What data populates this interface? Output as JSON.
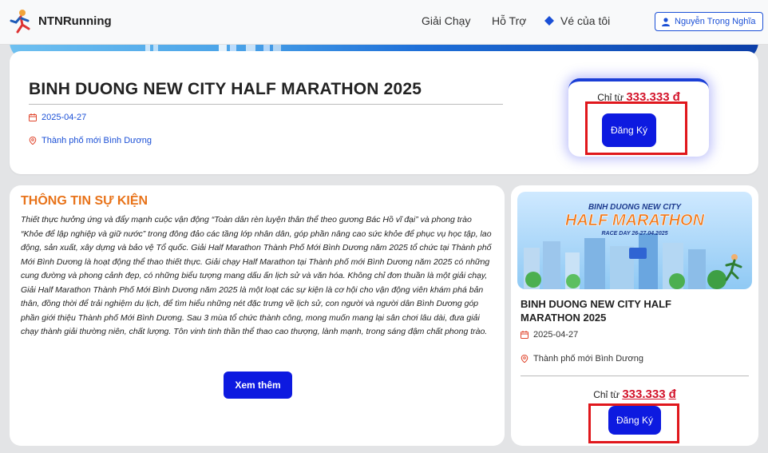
{
  "navbar": {
    "brand": "NTNRunning",
    "links": {
      "races": "Giải Chạy",
      "support": "Hỗ Trợ",
      "tickets": "Vé của tôi"
    },
    "user_name": "Nguyễn Trọng Nghĩa"
  },
  "event": {
    "title": "BINH DUONG NEW CITY HALF MARATHON 2025",
    "date": "2025-04-27",
    "location": "Thành phố mới Bình Dương",
    "price_prefix": "Chỉ từ",
    "price_value": "333.333",
    "currency": "đ",
    "register_label": "Đăng Ký"
  },
  "info": {
    "heading": "THÔNG TIN SỰ KIỆN",
    "body": "Thiết thực hưởng ứng và đẩy mạnh cuộc vận động “Toàn dân rèn luyện thân thể theo gương Bác Hồ vĩ đại” và phong trào “Khỏe để lập nghiệp và giữ nước” trong đông đảo các tầng lớp nhân dân, góp phần nâng cao sức khỏe để phục vụ học tập, lao động, sản xuất, xây dựng và bảo vệ Tổ quốc. Giải Half Marathon Thành Phố Mới Bình Dương năm 2025 tổ chức tại Thành phố Mới Bình Dương là hoạt động thể thao thiết thực. Giải chạy Half Marathon tại Thành phố mới Bình Dương năm 2025 có những cung đường và phong cảnh đẹp, có những biểu tượng mang dấu ấn lịch sử và văn hóa. Không chỉ đơn thuần là một giải chạy, Giải Half Marathon Thành Phố Mới Bình Dương năm 2025 là một loạt các sự kiện là cơ hội cho vận động viên khám phá bản thân, đồng thời để trải nghiệm du lịch, để tìm hiểu những nét đặc trưng về lịch sử, con người và người dân Bình Dương góp phần giới thiệu Thành phố Mới Bình Dương. Sau 3 mùa tổ chức thành công, mong muốn mang lại sân chơi lâu dài, đưa giải chạy thành giải thường niên, chất lượng. Tôn vinh tinh thần thể thao cao thượng, lành mạnh, trong sáng đậm chất phong trào.",
    "more_label": "Xem thêm"
  },
  "side_card": {
    "banner_line1": "BINH DUONG NEW CITY",
    "banner_line2": "HALF MARATHON",
    "banner_line3": "RACE DAY 26-27.04.2025",
    "title": "BINH DUONG NEW CITY HALF MARATHON 2025",
    "date": "2025-04-27",
    "location": "Thành phố mới Bình Dương",
    "price_prefix": "Chỉ từ",
    "price_value": "333.333",
    "currency": "đ",
    "register_label": "Đăng Ký"
  },
  "colors": {
    "primary": "#0d1ae0",
    "accent_orange": "#e8731a",
    "price_red": "#d3142b",
    "highlight_red": "#e0171c"
  }
}
